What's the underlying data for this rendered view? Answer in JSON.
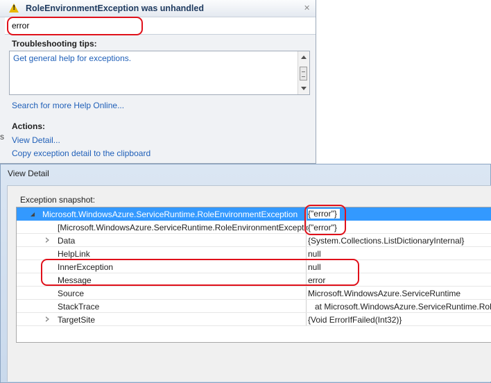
{
  "assistant": {
    "title": "RoleEnvironmentException was unhandled",
    "message": "error",
    "tips_header": "Troubleshooting tips:",
    "tips": [
      "Get general help for exceptions."
    ],
    "search_link": "Search for more Help Online...",
    "actions_header": "Actions:",
    "actions": [
      "View Detail...",
      "Copy exception detail to the clipboard"
    ]
  },
  "left_fragment": "s",
  "dialog": {
    "title": "View Detail",
    "snapshot_label": "Exception snapshot:",
    "rows": [
      {
        "name": "Microsoft.WindowsAzure.ServiceRuntime.RoleEnvironmentException",
        "value": "{\"error\"}"
      },
      {
        "name": "[Microsoft.WindowsAzure.ServiceRuntime.RoleEnvironmentException",
        "value": "{\"error\"}"
      },
      {
        "name": "Data",
        "value": "{System.Collections.ListDictionaryInternal}"
      },
      {
        "name": "HelpLink",
        "value": "null"
      },
      {
        "name": "InnerException",
        "value": "null"
      },
      {
        "name": "Message",
        "value": "error"
      },
      {
        "name": "Source",
        "value": "Microsoft.WindowsAzure.ServiceRuntime"
      },
      {
        "name": "StackTrace",
        "value": "at Microsoft.WindowsAzure.ServiceRuntime.Role"
      },
      {
        "name": "TargetSite",
        "value": "{Void ErrorIfFailed(Int32)}"
      }
    ]
  },
  "colors": {
    "highlight": "#e0101a",
    "selection": "#3399ff",
    "link": "#1f5fb8"
  }
}
